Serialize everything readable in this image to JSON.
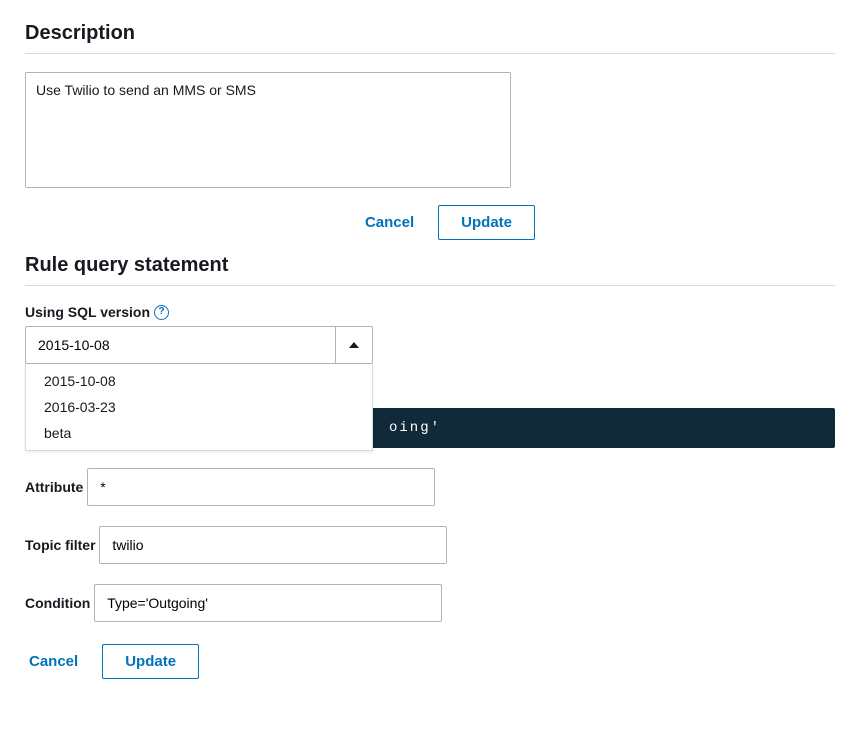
{
  "description": {
    "title": "Description",
    "value": "Use Twilio to send an MMS or SMS",
    "cancel": "Cancel",
    "update": "Update"
  },
  "rule": {
    "title": "Rule query statement",
    "sql_label": "Using SQL version",
    "sql_selected": "2015-10-08",
    "sql_options": {
      "o0": "2015-10-08",
      "o1": "2016-03-23",
      "o2": "beta"
    },
    "sql_strip": "oing'",
    "attribute_label": "Attribute",
    "attribute_value": "*",
    "topic_label": "Topic filter",
    "topic_value": "twilio",
    "condition_label": "Condition",
    "condition_value": "Type='Outgoing'",
    "cancel": "Cancel",
    "update": "Update"
  }
}
